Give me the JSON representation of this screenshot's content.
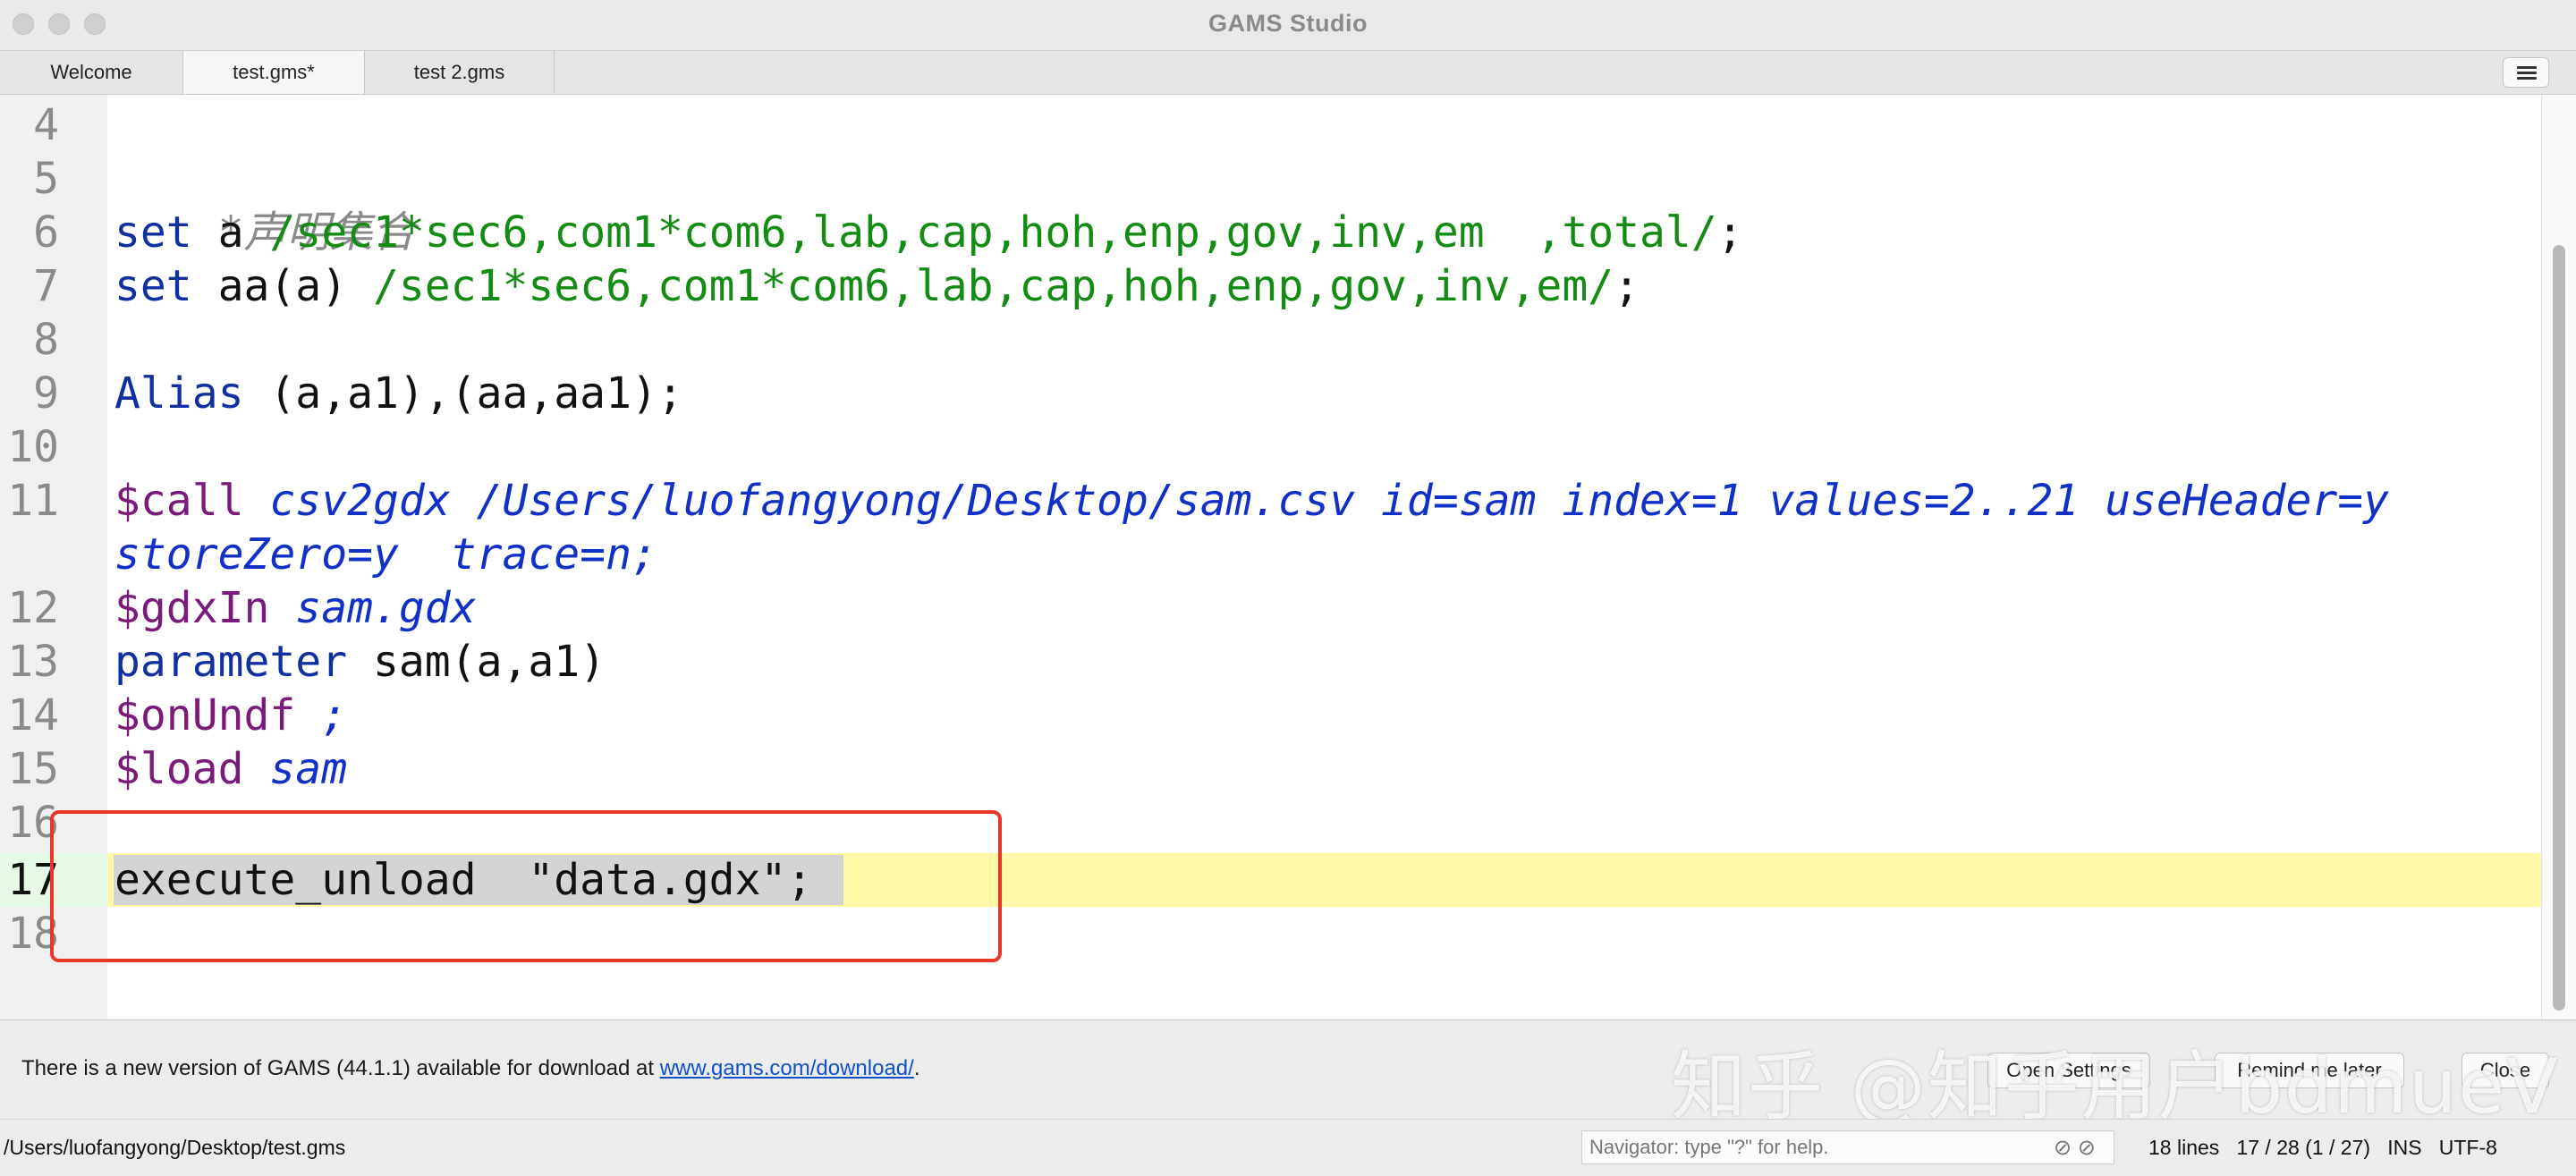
{
  "window": {
    "title": "GAMS Studio"
  },
  "tabs": [
    {
      "label": "Welcome"
    },
    {
      "label": "test.gms*"
    },
    {
      "label": "test 2.gms"
    }
  ],
  "editor": {
    "line_numbers": [
      "4",
      "5",
      "6",
      "7",
      "8",
      "9",
      "10",
      "11",
      "",
      "12",
      "13",
      "14",
      "15",
      "16",
      "17",
      "18"
    ],
    "lines": {
      "l5_comment": "*声明集合",
      "l6_kw": "set",
      "l6_name": " a ",
      "l6_list": "/sec1*sec6,com1*com6,lab,cap,hoh,enp,gov,inv,em  ,total/",
      "l6_end": ";",
      "l7_kw": "set",
      "l7_name": " aa(a) ",
      "l7_list": "/sec1*sec6,com1*com6,lab,cap,hoh,enp,gov,inv,em/",
      "l7_end": ";",
      "l9_kw": "Alias",
      "l9_rest": " (a,a1),(aa,aa1);",
      "l11_dol": "$call",
      "l11_args": " csv2gdx /Users/luofangyong/Desktop/sam.csv id=sam index=1 values=2..21 useHeader=y",
      "l11_wrap": "storeZero=y  trace=n;",
      "l12_dol": "$gdxIn",
      "l12_arg": " sam.gdx",
      "l13_kw": "parameter",
      "l13_rest": " sam(a,a1)",
      "l14_dol": "$onUndf",
      "l14_arg": " ;",
      "l15_dol": "$load",
      "l15_arg": " sam",
      "l17_code": "execute_unload  \"data.gdx\";"
    }
  },
  "notification": {
    "text": "There is a new version of GAMS (44.1.1) available for download at ",
    "link": "www.gams.com/download/",
    "suffix": ".",
    "open_settings": "Open Settings",
    "remind_later": "Remind me later",
    "close": "Close"
  },
  "watermark": "知乎 @知乎用户bdmueV",
  "statusbar": {
    "path": "/Users/luofangyong/Desktop/test.gms",
    "navigator_placeholder": "Navigator: type \"?\" for help.",
    "lines": "18 lines",
    "position": "17 / 28 (1 / 27)",
    "mode": "INS",
    "encoding": "UTF-8"
  }
}
